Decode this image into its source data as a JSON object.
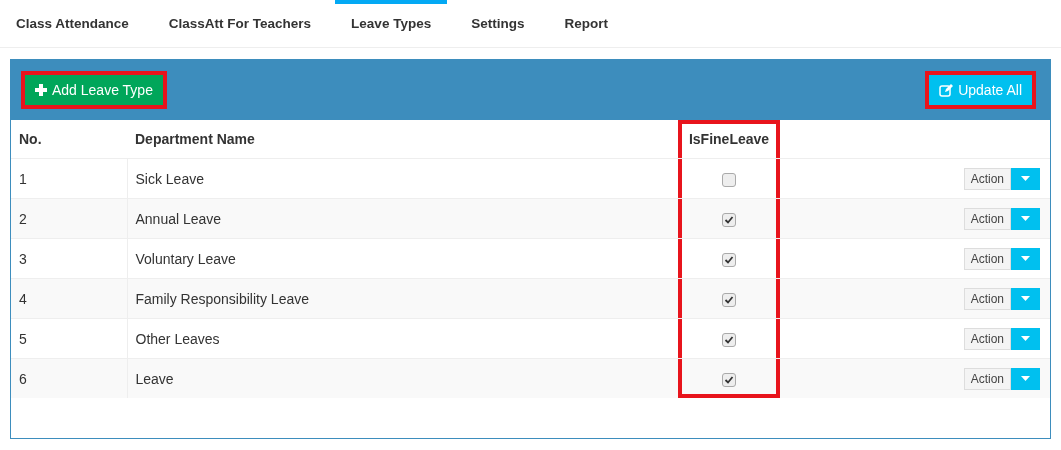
{
  "tabs": [
    {
      "label": "Class Attendance",
      "selected": false
    },
    {
      "label": "ClassAtt For Teachers",
      "selected": false
    },
    {
      "label": "Leave Types",
      "selected": true
    },
    {
      "label": "Settings",
      "selected": false
    },
    {
      "label": "Report",
      "selected": false
    }
  ],
  "toolbar": {
    "add_button": {
      "label": "Add Leave Type",
      "highlighted": true
    },
    "update_button": {
      "label": "Update All",
      "highlighted": true
    }
  },
  "table": {
    "columns": [
      {
        "label": "No.",
        "highlighted": false
      },
      {
        "label": "Department Name",
        "highlighted": false
      },
      {
        "label": "IsFineLeave",
        "highlighted": true
      }
    ],
    "rows": [
      {
        "no": "1",
        "name": "Sick Leave",
        "is_fine_leave": false,
        "action": "Action"
      },
      {
        "no": "2",
        "name": "Annual Leave",
        "is_fine_leave": true,
        "action": "Action"
      },
      {
        "no": "3",
        "name": "Voluntary Leave",
        "is_fine_leave": true,
        "action": "Action"
      },
      {
        "no": "4",
        "name": "Family Responsibility Leave",
        "is_fine_leave": true,
        "action": "Action"
      },
      {
        "no": "5",
        "name": "Other Leaves",
        "is_fine_leave": true,
        "action": "Action"
      },
      {
        "no": "6",
        "name": "Leave",
        "is_fine_leave": true,
        "action": "Action"
      }
    ]
  }
}
